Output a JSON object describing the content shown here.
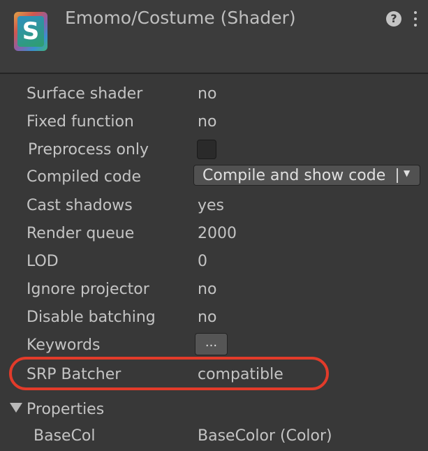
{
  "header": {
    "icon_letter": "S",
    "title": "Emomo/Costume (Shader)",
    "help_glyph": "?"
  },
  "rows": {
    "surface_shader": {
      "label": "Surface shader",
      "value": "no"
    },
    "fixed_function": {
      "label": "Fixed function",
      "value": "no"
    },
    "preprocess_only": {
      "label": "Preprocess only",
      "checked": false
    },
    "compiled_code": {
      "label": "Compiled code",
      "dropdown": "Compile and show code",
      "arrow": "▼"
    },
    "cast_shadows": {
      "label": "Cast shadows",
      "value": "yes"
    },
    "render_queue": {
      "label": "Render queue",
      "value": "2000"
    },
    "lod": {
      "label": "LOD",
      "value": "0"
    },
    "ignore_projector": {
      "label": "Ignore projector",
      "value": "no"
    },
    "disable_batching": {
      "label": "Disable batching",
      "value": "no"
    },
    "keywords": {
      "label": "Keywords",
      "button": "..."
    },
    "srp_batcher": {
      "label": "SRP Batcher",
      "value": "compatible"
    }
  },
  "properties": {
    "label": "Properties",
    "items": [
      {
        "name": "BaseCol",
        "value": "BaseColor (Color)"
      }
    ]
  },
  "colors": {
    "highlight": "#e23b2a",
    "background": "#383838"
  }
}
